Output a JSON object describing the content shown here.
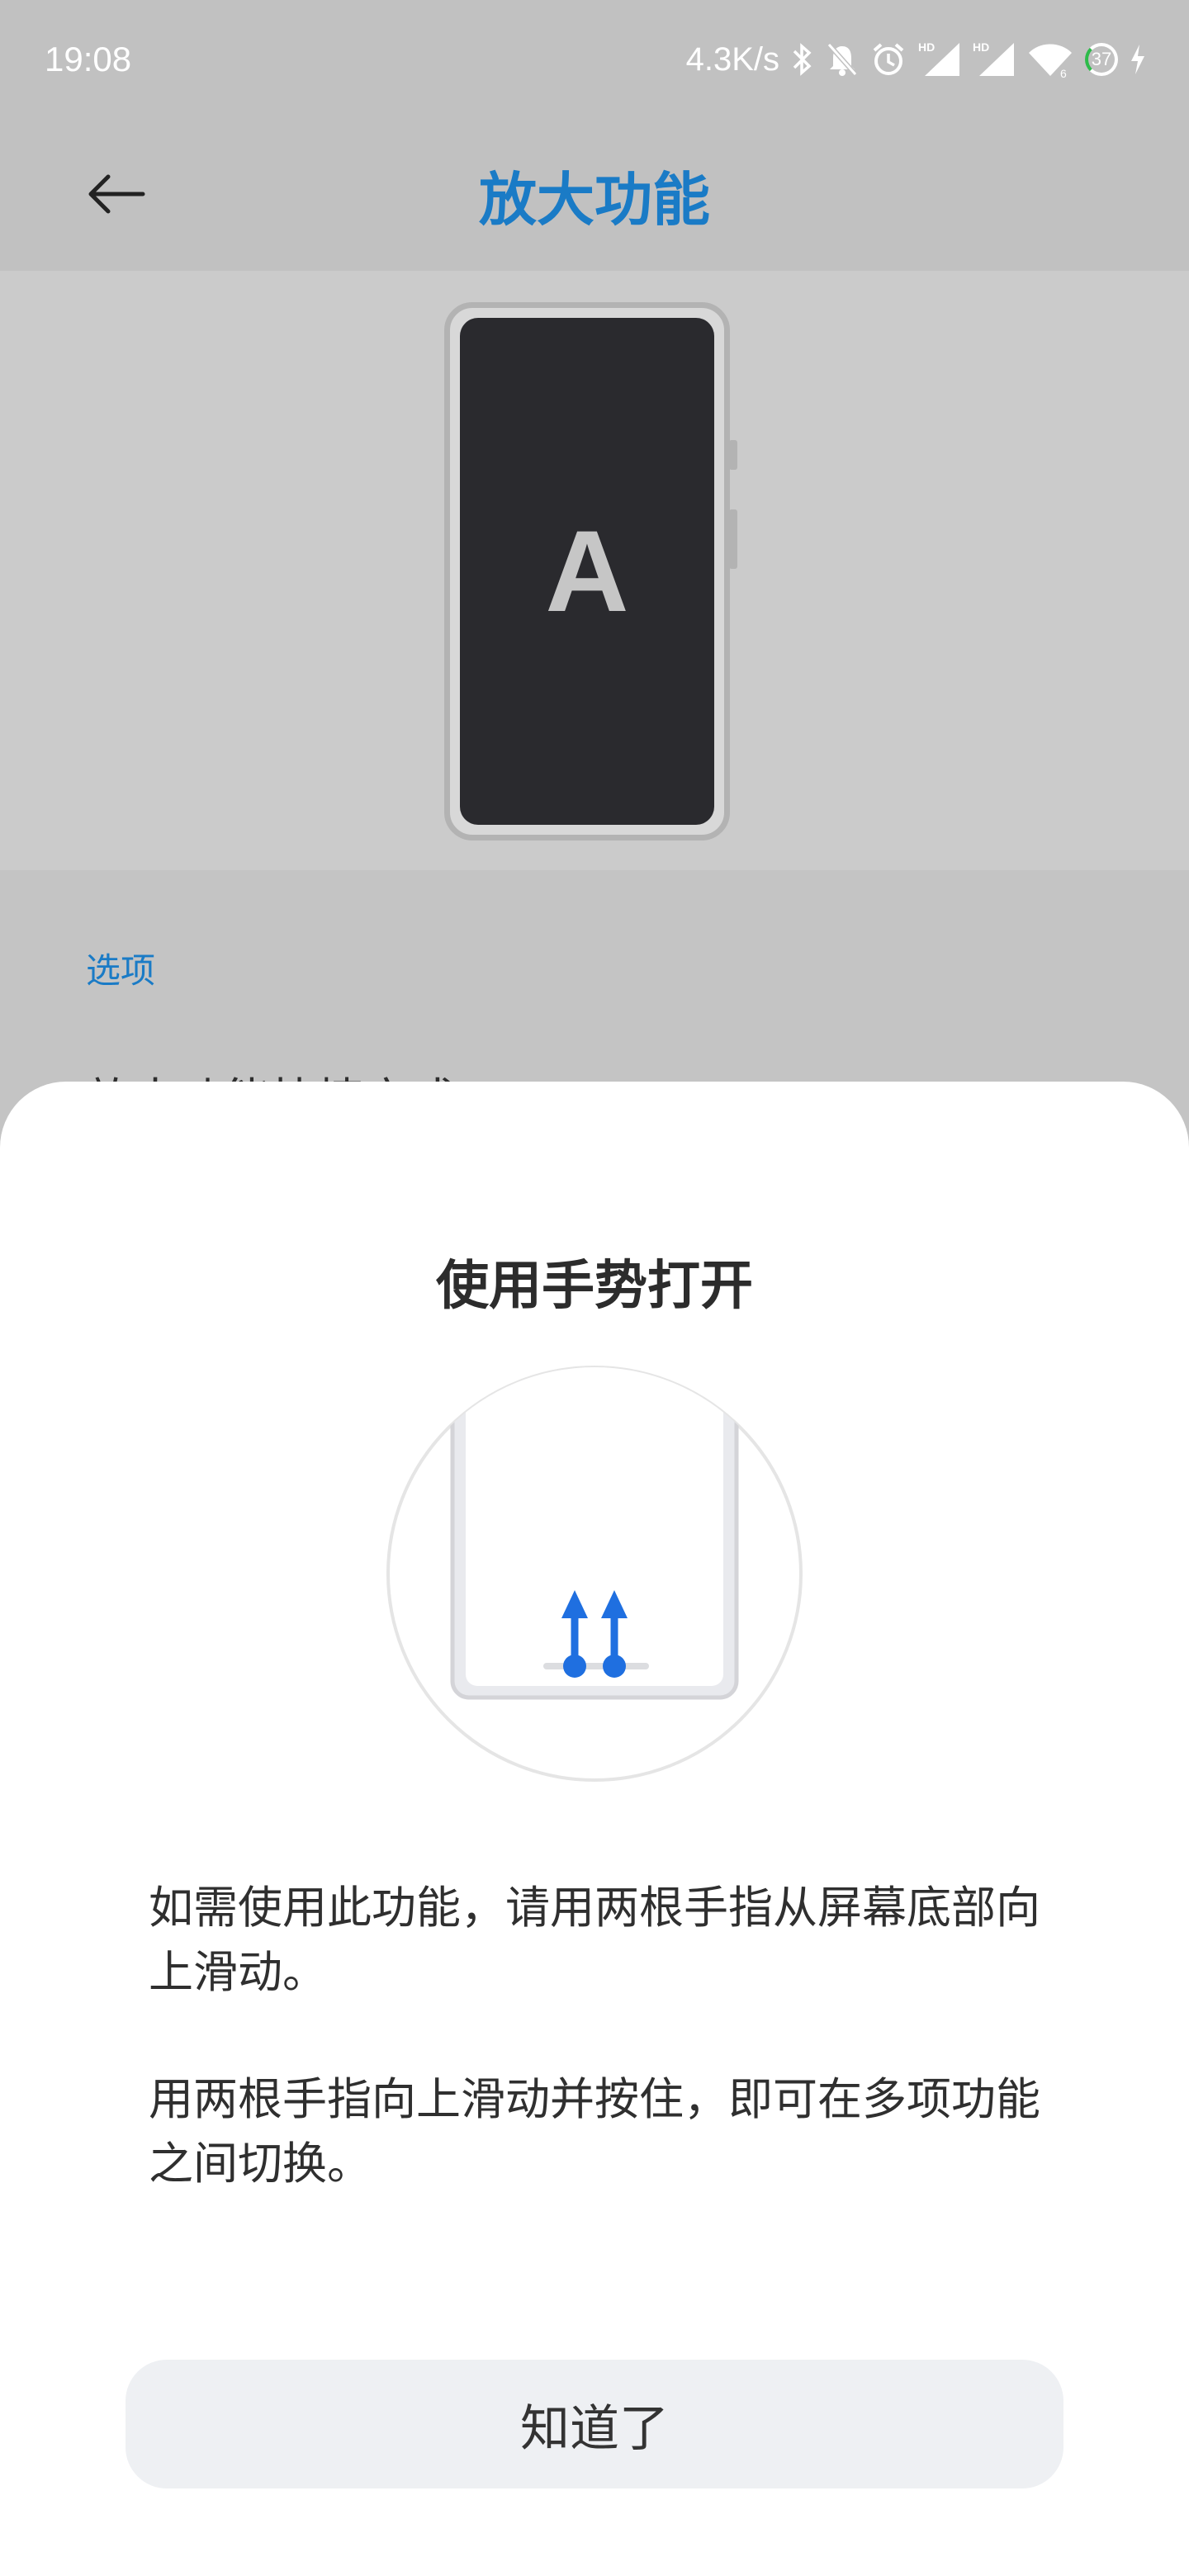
{
  "status_bar": {
    "time": "19:08",
    "net_speed": "4.3K/s",
    "battery_level": "37",
    "icons": [
      "bluetooth-icon",
      "mute-icon",
      "alarm-icon",
      "signal-hd-icon",
      "signal-hd-icon",
      "wifi-icon",
      "battery-icon",
      "charging-icon"
    ]
  },
  "app_bar": {
    "title": "放大功能",
    "back_icon": "arrow-left-icon"
  },
  "hero": {
    "letter": "A"
  },
  "options": {
    "section_label": "选项",
    "partial_row": "放大功能快捷方式"
  },
  "sheet": {
    "title": "使用手势打开",
    "paragraph_1": "如需使用此功能，请用两根手指从屏幕底部向上滑动。",
    "paragraph_2": "用两根手指向上滑动并按住，即可在多项功能之间切换。",
    "button_label": "知道了"
  },
  "colors": {
    "accent": "#1a7bc6",
    "gesture_blue": "#1f6fe0",
    "sheet_bg": "#ffffff",
    "button_bg": "#eef0f3"
  }
}
